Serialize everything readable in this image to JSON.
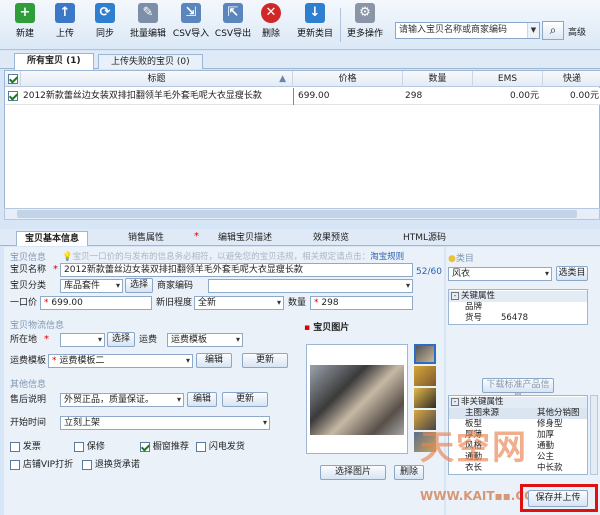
{
  "toolbar": {
    "buttons": [
      {
        "label": "新建",
        "icon": "new-icon",
        "color": "#2f9e3a",
        "glyph": "+"
      },
      {
        "label": "上传",
        "icon": "upload-icon",
        "color": "#3b78c8",
        "glyph": "↑"
      },
      {
        "label": "同步",
        "icon": "sync-icon",
        "color": "#2f7fd0",
        "glyph": "⟳"
      },
      {
        "label": "批量编辑",
        "icon": "batch-edit-icon",
        "color": "#7d8fa8",
        "glyph": "✎"
      },
      {
        "label": "CSV导入",
        "icon": "csv-import-icon",
        "color": "#5a86bd",
        "glyph": "⇲"
      },
      {
        "label": "CSV导出",
        "icon": "csv-export-icon",
        "color": "#5a86bd",
        "glyph": "⇱"
      },
      {
        "label": "删除",
        "icon": "delete-icon",
        "color": "#d02828",
        "glyph": "✕"
      },
      {
        "label": "更新类目",
        "icon": "update-category-icon",
        "color": "#2f7fd0",
        "glyph": "↓"
      },
      {
        "label": "更多操作",
        "icon": "more-actions-icon",
        "color": "#8a96a8",
        "glyph": "⚙"
      }
    ],
    "search_placeholder": "请输入宝贝名称或商家编码",
    "advanced": "高级"
  },
  "list_tabs": [
    "所有宝贝 (1)",
    "上传失败的宝贝 (0)"
  ],
  "grid": {
    "headers": [
      "标题",
      "价格",
      "数量",
      "EMS",
      "快递"
    ],
    "rows": [
      {
        "title": "2012新款蕾丝边女装双排扣翻领羊毛外套毛呢大衣显瘦长款",
        "price": "699.00",
        "qty": "298",
        "ems": "0.00元",
        "express": "0.00元"
      }
    ]
  },
  "detail_tabs": [
    "宝贝基本信息",
    "销售属性",
    "编辑宝贝描述",
    "效果预览",
    "HTML源码"
  ],
  "form": {
    "section_item": "宝贝信息",
    "tip": "宝贝一口价的与发布的信息务必相符，以避免您的宝贝违规，相关规定请点击：",
    "tip_link": "淘宝规则",
    "name_label": "宝贝名称",
    "name_value": "2012新款蕾丝边女装双排扣翻领羊毛外套毛呢大衣显瘦长款",
    "name_count": "52/60",
    "category_label": "宝贝分类",
    "category_value": "库品套件",
    "select_btn": "选择",
    "merchant_code_label": "商家编码",
    "price_label": "一口价",
    "price_value": "699.00",
    "condition_label": "新旧程度",
    "condition_value": "全新",
    "qty_label": "数量",
    "qty_value": "298",
    "section_logistics": "宝贝物流信息",
    "location_label": "所在地",
    "location_btn": "选择",
    "freight_label": "运费",
    "freight_value": "运费模板",
    "freight_tpl_label": "运费模板",
    "freight_tpl_value": "运费模板二",
    "edit_btn": "编辑",
    "update_btn": "更新",
    "section_other": "其他信息",
    "aftersale_label": "售后说明",
    "aftersale_value": "外贸正品，质量保证。",
    "aftersale_edit": "编辑",
    "aftersale_update": "更新",
    "start_label": "开始时间",
    "start_value": "立刻上架",
    "checks": [
      {
        "label": "发票",
        "checked": false
      },
      {
        "label": "保修",
        "checked": false
      },
      {
        "label": "橱窗推荐",
        "checked": true
      },
      {
        "label": "闪电发货",
        "checked": false
      },
      {
        "label": "店铺VIP打折",
        "checked": false
      },
      {
        "label": "退换货承诺",
        "checked": false
      }
    ],
    "images_title": "宝贝图片",
    "select_image_btn": "选择图片",
    "delete_image_btn": "删除"
  },
  "right": {
    "category_title": "类目",
    "category_value": "风衣",
    "select_category_btn": "选类目",
    "key_attr_title": "关键属性",
    "key_attrs": [
      {
        "k": "品牌",
        "v": ""
      },
      {
        "k": "货号",
        "v": "56478"
      }
    ],
    "download_btn": "下载标准产品信息",
    "nonkey_title": "非关键属性",
    "nonkey_attrs": [
      {
        "k": "主图来源",
        "v": "其他分销图"
      },
      {
        "k": "板型",
        "v": "修身型"
      },
      {
        "k": "厚薄",
        "v": "加厚"
      },
      {
        "k": "风格",
        "v": "通勤"
      },
      {
        "k": "通勤",
        "v": "公主"
      },
      {
        "k": "衣长",
        "v": "中长款"
      }
    ]
  },
  "save_upload_btn": "保存并上传",
  "watermark": {
    "main": "天空网",
    "sub": "WWW.KAIT▪▪.COM"
  }
}
